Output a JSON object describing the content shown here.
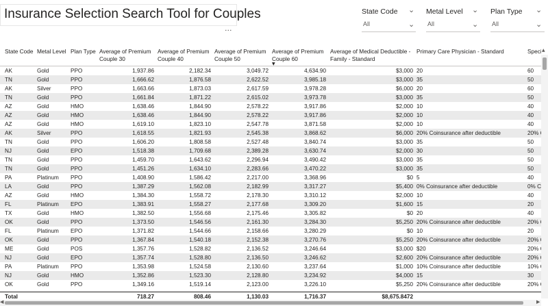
{
  "title": "Insurance Selection Search Tool for Couples",
  "more_options": "···",
  "slicers": [
    {
      "label": "State Code",
      "value": "All"
    },
    {
      "label": "Metal Level",
      "value": "All"
    },
    {
      "label": "Plan Type",
      "value": "All"
    }
  ],
  "table": {
    "columns": [
      "State Code",
      "Metal Level",
      "Plan Type",
      "Average of Premium Couple 30",
      "Average of Premium Couple 40",
      "Average of Premium Couple 50",
      "Average of Premium Couple 60",
      "Average of Medical Deductible - Family - Standard",
      "Primary Care Physician - Standard",
      "Speci..."
    ],
    "rows": [
      [
        "AK",
        "Gold",
        "PPO",
        "1,937.86",
        "2,182.34",
        "3,049.72",
        "4,634.90",
        "$3,000",
        "20",
        "60"
      ],
      [
        "TN",
        "Gold",
        "PPO",
        "1,666.62",
        "1,876.58",
        "2,622.52",
        "3,985.18",
        "$3,000",
        "35",
        "50"
      ],
      [
        "AK",
        "Silver",
        "PPO",
        "1,663.66",
        "1,873.03",
        "2,617.59",
        "3,978.28",
        "$6,000",
        "20",
        "60"
      ],
      [
        "TN",
        "Gold",
        "PPO",
        "1,661.84",
        "1,871.22",
        "2,615.02",
        "3,973.78",
        "$3,000",
        "35",
        "50"
      ],
      [
        "AZ",
        "Gold",
        "HMO",
        "1,638.46",
        "1,844.90",
        "2,578.22",
        "3,917.86",
        "$2,000",
        "10",
        "40"
      ],
      [
        "AZ",
        "Gold",
        "HMO",
        "1,638.46",
        "1,844.90",
        "2,578.22",
        "3,917.86",
        "$2,000",
        "10",
        "40"
      ],
      [
        "AZ",
        "Gold",
        "HMO",
        "1,619.10",
        "1,823.10",
        "2,547.78",
        "3,871.58",
        "$2,000",
        "10",
        "40"
      ],
      [
        "AK",
        "Silver",
        "PPO",
        "1,618.55",
        "1,821.93",
        "2,545.38",
        "3,868.62",
        "$6,000",
        "20% Coinsurance after deductible",
        "20% C"
      ],
      [
        "TN",
        "Gold",
        "PPO",
        "1,606.20",
        "1,808.58",
        "2,527.48",
        "3,840.74",
        "$3,000",
        "35",
        "50"
      ],
      [
        "NJ",
        "Gold",
        "EPO",
        "1,518.38",
        "1,709.68",
        "2,389.28",
        "3,630.74",
        "$2,000",
        "30",
        "50"
      ],
      [
        "TN",
        "Gold",
        "PPO",
        "1,459.70",
        "1,643.62",
        "2,296.94",
        "3,490.42",
        "$3,000",
        "35",
        "50"
      ],
      [
        "TN",
        "Gold",
        "PPO",
        "1,451.26",
        "1,634.10",
        "2,283.66",
        "3,470.22",
        "$3,000",
        "35",
        "50"
      ],
      [
        "PA",
        "Platinum",
        "PPO",
        "1,408.90",
        "1,586.42",
        "2,217.00",
        "3,368.96",
        "$0",
        "5",
        "40"
      ],
      [
        "LA",
        "Gold",
        "PPO",
        "1,387.29",
        "1,562.08",
        "2,182.99",
        "3,317.27",
        "$5,400",
        "0% Coinsurance after deductible",
        "0% C"
      ],
      [
        "AZ",
        "Gold",
        "HMO",
        "1,384.30",
        "1,558.72",
        "2,178.30",
        "3,310.12",
        "$2,000",
        "10",
        "40"
      ],
      [
        "FL",
        "Platinum",
        "EPO",
        "1,383.91",
        "1,558.27",
        "2,177.68",
        "3,309.20",
        "$1,600",
        "15",
        "20"
      ],
      [
        "TX",
        "Gold",
        "HMO",
        "1,382.50",
        "1,556.68",
        "2,175.46",
        "3,305.82",
        "$0",
        "20",
        "40"
      ],
      [
        "OK",
        "Gold",
        "PPO",
        "1,373.50",
        "1,546.56",
        "2,161.30",
        "3,284.30",
        "$5,250",
        "20% Coinsurance after deductible",
        "20% C"
      ],
      [
        "FL",
        "Platinum",
        "EPO",
        "1,371.82",
        "1,544.66",
        "2,158.66",
        "3,280.29",
        "$0",
        "10",
        "20"
      ],
      [
        "OK",
        "Gold",
        "PPO",
        "1,367.84",
        "1,540.18",
        "2,152.38",
        "3,270.76",
        "$5,250",
        "20% Coinsurance after deductible",
        "20% C"
      ],
      [
        "ME",
        "Gold",
        "POS",
        "1,357.76",
        "1,528.82",
        "2,136.52",
        "3,246.64",
        "$3,000",
        "$20",
        "20% C"
      ],
      [
        "NJ",
        "Gold",
        "EPO",
        "1,357.74",
        "1,528.80",
        "2,136.50",
        "3,246.62",
        "$2,600",
        "20% Coinsurance after deductible",
        "20% C"
      ],
      [
        "PA",
        "Platinum",
        "PPO",
        "1,353.98",
        "1,524.58",
        "2,130.60",
        "3,237.64",
        "$1,000",
        "10% Coinsurance after deductible",
        "10% C"
      ],
      [
        "NJ",
        "Gold",
        "HMO",
        "1,352.86",
        "1,523.30",
        "2,128.80",
        "3,234.92",
        "$4,000",
        "15",
        "30"
      ],
      [
        "OK",
        "Gold",
        "PPO",
        "1,349.16",
        "1,519.14",
        "2,123.00",
        "3,226.10",
        "$5,250",
        "20% Coinsurance after deductible",
        "20% C"
      ]
    ],
    "total": {
      "label": "Total",
      "values": [
        "718.27",
        "808.46",
        "1,130.03",
        "1,716.37",
        "$8,675.8472"
      ]
    }
  }
}
